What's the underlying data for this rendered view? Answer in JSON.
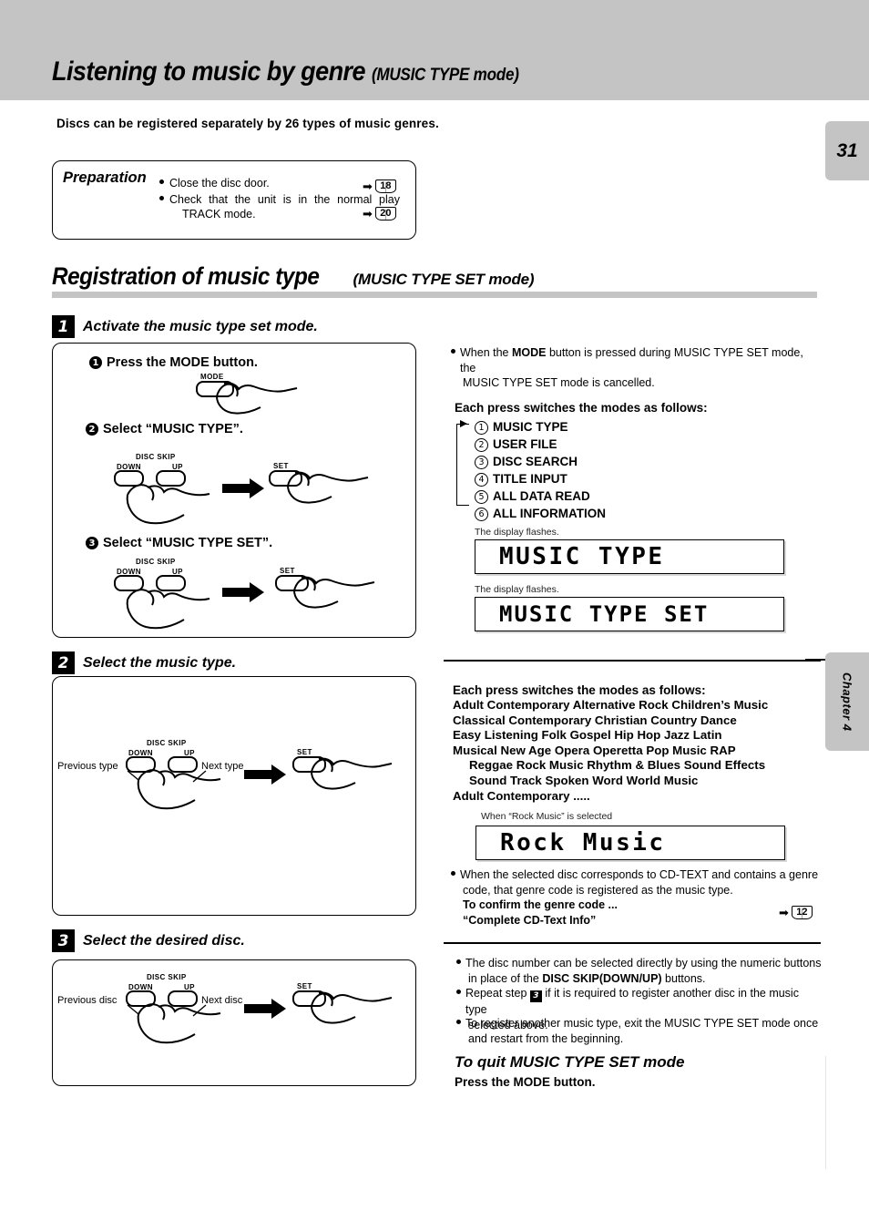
{
  "header": {
    "title_main": "Listening to music by genre",
    "title_sub": "(MUSIC TYPE mode)"
  },
  "tabs": {
    "page_number": "31",
    "chapter": "Chapter 4"
  },
  "intro": "Discs can be registered separately by 26 types of music genres.",
  "preparation": {
    "title": "Preparation",
    "item1": "Close the disc door.",
    "item1_ref": "18",
    "item2_line1": "Check that the unit is in the normal play",
    "item2_line2": "TRACK mode.",
    "item2_ref": "20",
    "arrow": "➡"
  },
  "section": {
    "title_main": "Registration of music type",
    "title_sub": "(MUSIC TYPE SET mode)"
  },
  "steps": [
    {
      "number": "1",
      "label": "Activate the music type set mode."
    },
    {
      "number": "2",
      "label": "Select the music type."
    },
    {
      "number": "3",
      "label": "Select the desired disc."
    }
  ],
  "step1": {
    "sub1_num": "❶",
    "sub1_text": "Press the MODE button.",
    "sub2_num": "❷",
    "sub2_text": "Select “MUSIC TYPE”.",
    "sub3_num": "❸",
    "sub3_text": "Select “MUSIC TYPE SET”.",
    "key_mode": "MODE",
    "key_discskip": "DISC SKIP",
    "key_down": "DOWN",
    "key_up": "UP",
    "key_set": "SET"
  },
  "step2": {
    "key_discskip": "DISC SKIP",
    "key_down": "DOWN",
    "key_up": "UP",
    "key_set": "SET",
    "label_prev": "Previous type",
    "label_next": "Next type"
  },
  "step3": {
    "key_discskip": "DISC SKIP",
    "key_down": "DOWN",
    "key_up": "UP",
    "key_set": "SET",
    "label_prev": "Previous disc",
    "label_next": "Next disc"
  },
  "right": {
    "note_mode_line1_a": "When the ",
    "note_mode_bold": "MODE",
    "note_mode_line1_b": " button is pressed during MUSIC TYPE SET mode, the",
    "note_mode_line2": "MUSIC TYPE SET mode is cancelled.",
    "modes_heading": "Each press switches the modes as follows:",
    "modes": [
      {
        "num": "1",
        "label": "MUSIC TYPE"
      },
      {
        "num": "2",
        "label": "USER FILE"
      },
      {
        "num": "3",
        "label": "DISC SEARCH"
      },
      {
        "num": "4",
        "label": "TITLE INPUT"
      },
      {
        "num": "5",
        "label": "ALL DATA READ"
      },
      {
        "num": "6",
        "label": "ALL INFORMATION"
      }
    ],
    "lcd1_caption": "The display flashes.",
    "lcd1_text": "MUSIC TYPE",
    "lcd2_caption": "The display flashes.",
    "lcd2_text": "MUSIC TYPE SET",
    "genre_heading": "Each press switches the modes as follows:",
    "genre_lines": [
      "Adult Contemporary    Alternative Rock    Children’s Music",
      "Classical    Contemporary Christian    Country    Dance",
      "Easy Listening    Folk    Gospel    Hip Hop    Jazz    Latin",
      "Musical    New Age    Opera    Operetta    Pop Music    RAP",
      "Reggae    Rock Music    Rhythm & Blues    Sound Effects",
      "Sound Track    Spoken Word    World Music",
      "Adult Contemporary      ....."
    ],
    "lcd3_caption": "When “Rock Music” is selected",
    "lcd3_text": "Rock Music",
    "cdtext_line1": "When the selected disc corresponds to CD-TEXT and contains a genre",
    "cdtext_line2": "code, that genre code is registered as the music type.",
    "cdtext_line3": "To confirm the genre code ...",
    "cdtext_line4": "“Complete CD-Text Info”",
    "cdtext_ref": "12",
    "bullet1_a": "The disc number can be selected directly by using the numeric buttons",
    "bullet1_b1": "in place of the ",
    "bullet1_bold": "DISC SKIP",
    "bullet1_bold2": "(DOWN/UP)",
    "bullet1_b2": " buttons.",
    "bullet2_a": "Repeat step ",
    "bullet2_step": "3",
    "bullet2_b": " if it is required to register another disc in the music type",
    "bullet2_c": "selected above.",
    "bullet3_a": "To register another music type, exit the MUSIC TYPE SET mode once",
    "bullet3_b": "and restart from the beginning.",
    "quit_heading": "To quit MUSIC TYPE SET mode",
    "quit_sub": "Press the MODE button."
  },
  "colors": {
    "header_gray": "#c4c4c4",
    "rule_gray": "#c4c4c4",
    "ink": "#000000"
  }
}
